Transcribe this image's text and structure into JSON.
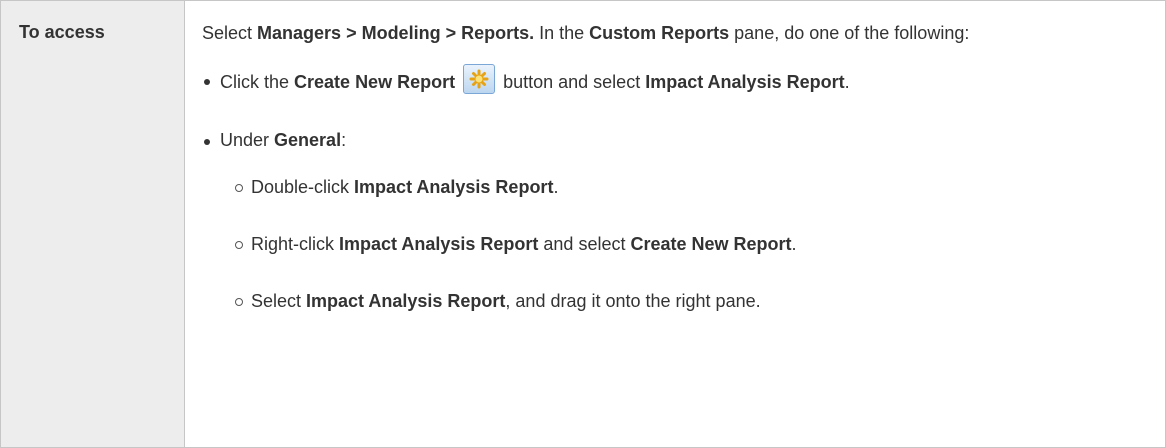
{
  "label": "To access",
  "intro": {
    "t1": "Select ",
    "b1": "Managers > Modeling > Reports.",
    "t2": " In the ",
    "b2": "Custom Reports",
    "t3": " pane, do one of the following:"
  },
  "bullet1": {
    "t1": "Click the ",
    "b1": "Create New Report",
    "icon": "create-new-report-icon",
    "t2": " button and select ",
    "b2": "Impact Analysis Report",
    "t3": "."
  },
  "bullet2": {
    "t1": "Under ",
    "b1": "General",
    "t2": ":"
  },
  "sub1": {
    "t1": "Double-click ",
    "b1": "Impact Analysis Report",
    "t2": "."
  },
  "sub2": {
    "t1": "Right-click ",
    "b1": "Impact Analysis Report",
    "t2": " and select ",
    "b2": "Create New Report",
    "t3": "."
  },
  "sub3": {
    "t1": "Select ",
    "b1": "Impact Analysis Report",
    "t2": ", and drag it onto the right pane."
  }
}
